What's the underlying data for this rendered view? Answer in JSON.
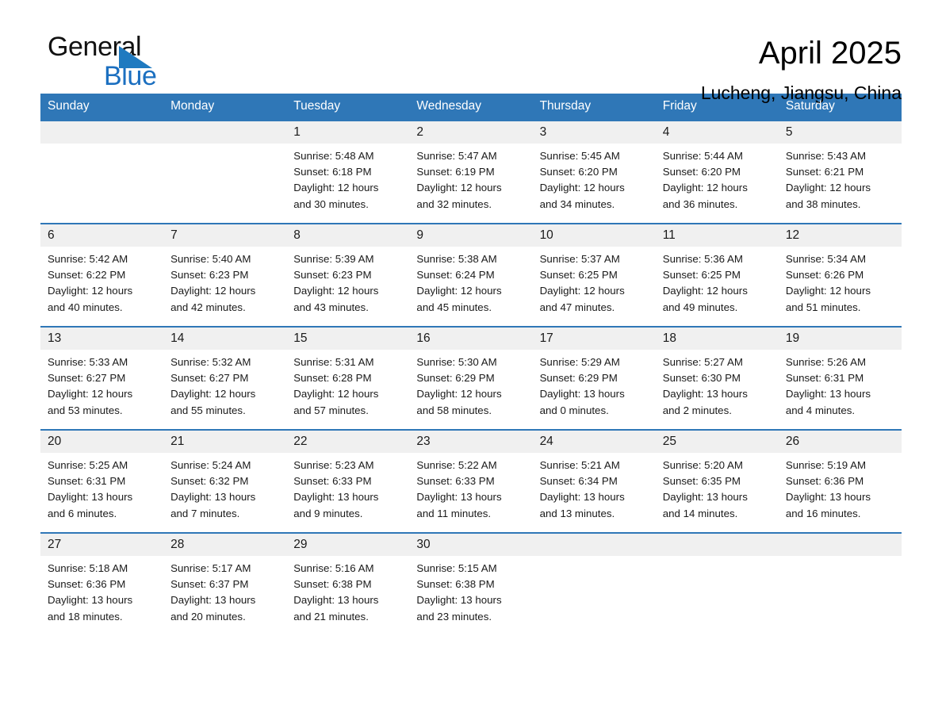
{
  "brand": {
    "name_top": "General",
    "name_bottom": "Blue",
    "accent_color": "#1b6fc0",
    "header_color": "#2f77b7"
  },
  "header": {
    "title": "April 2025",
    "subtitle": "Lucheng, Jiangsu, China"
  },
  "weekdays": [
    "Sunday",
    "Monday",
    "Tuesday",
    "Wednesday",
    "Thursday",
    "Friday",
    "Saturday"
  ],
  "labels": {
    "sunrise_prefix": "Sunrise: ",
    "sunset_prefix": "Sunset: ",
    "daylight_prefix": "Daylight: "
  },
  "weeks": [
    [
      {
        "day": "",
        "sunrise": "",
        "sunset": "",
        "daylight_line1": "",
        "daylight_line2": ""
      },
      {
        "day": "",
        "sunrise": "",
        "sunset": "",
        "daylight_line1": "",
        "daylight_line2": ""
      },
      {
        "day": "1",
        "sunrise": "Sunrise: 5:48 AM",
        "sunset": "Sunset: 6:18 PM",
        "daylight_line1": "Daylight: 12 hours",
        "daylight_line2": "and 30 minutes."
      },
      {
        "day": "2",
        "sunrise": "Sunrise: 5:47 AM",
        "sunset": "Sunset: 6:19 PM",
        "daylight_line1": "Daylight: 12 hours",
        "daylight_line2": "and 32 minutes."
      },
      {
        "day": "3",
        "sunrise": "Sunrise: 5:45 AM",
        "sunset": "Sunset: 6:20 PM",
        "daylight_line1": "Daylight: 12 hours",
        "daylight_line2": "and 34 minutes."
      },
      {
        "day": "4",
        "sunrise": "Sunrise: 5:44 AM",
        "sunset": "Sunset: 6:20 PM",
        "daylight_line1": "Daylight: 12 hours",
        "daylight_line2": "and 36 minutes."
      },
      {
        "day": "5",
        "sunrise": "Sunrise: 5:43 AM",
        "sunset": "Sunset: 6:21 PM",
        "daylight_line1": "Daylight: 12 hours",
        "daylight_line2": "and 38 minutes."
      }
    ],
    [
      {
        "day": "6",
        "sunrise": "Sunrise: 5:42 AM",
        "sunset": "Sunset: 6:22 PM",
        "daylight_line1": "Daylight: 12 hours",
        "daylight_line2": "and 40 minutes."
      },
      {
        "day": "7",
        "sunrise": "Sunrise: 5:40 AM",
        "sunset": "Sunset: 6:23 PM",
        "daylight_line1": "Daylight: 12 hours",
        "daylight_line2": "and 42 minutes."
      },
      {
        "day": "8",
        "sunrise": "Sunrise: 5:39 AM",
        "sunset": "Sunset: 6:23 PM",
        "daylight_line1": "Daylight: 12 hours",
        "daylight_line2": "and 43 minutes."
      },
      {
        "day": "9",
        "sunrise": "Sunrise: 5:38 AM",
        "sunset": "Sunset: 6:24 PM",
        "daylight_line1": "Daylight: 12 hours",
        "daylight_line2": "and 45 minutes."
      },
      {
        "day": "10",
        "sunrise": "Sunrise: 5:37 AM",
        "sunset": "Sunset: 6:25 PM",
        "daylight_line1": "Daylight: 12 hours",
        "daylight_line2": "and 47 minutes."
      },
      {
        "day": "11",
        "sunrise": "Sunrise: 5:36 AM",
        "sunset": "Sunset: 6:25 PM",
        "daylight_line1": "Daylight: 12 hours",
        "daylight_line2": "and 49 minutes."
      },
      {
        "day": "12",
        "sunrise": "Sunrise: 5:34 AM",
        "sunset": "Sunset: 6:26 PM",
        "daylight_line1": "Daylight: 12 hours",
        "daylight_line2": "and 51 minutes."
      }
    ],
    [
      {
        "day": "13",
        "sunrise": "Sunrise: 5:33 AM",
        "sunset": "Sunset: 6:27 PM",
        "daylight_line1": "Daylight: 12 hours",
        "daylight_line2": "and 53 minutes."
      },
      {
        "day": "14",
        "sunrise": "Sunrise: 5:32 AM",
        "sunset": "Sunset: 6:27 PM",
        "daylight_line1": "Daylight: 12 hours",
        "daylight_line2": "and 55 minutes."
      },
      {
        "day": "15",
        "sunrise": "Sunrise: 5:31 AM",
        "sunset": "Sunset: 6:28 PM",
        "daylight_line1": "Daylight: 12 hours",
        "daylight_line2": "and 57 minutes."
      },
      {
        "day": "16",
        "sunrise": "Sunrise: 5:30 AM",
        "sunset": "Sunset: 6:29 PM",
        "daylight_line1": "Daylight: 12 hours",
        "daylight_line2": "and 58 minutes."
      },
      {
        "day": "17",
        "sunrise": "Sunrise: 5:29 AM",
        "sunset": "Sunset: 6:29 PM",
        "daylight_line1": "Daylight: 13 hours",
        "daylight_line2": "and 0 minutes."
      },
      {
        "day": "18",
        "sunrise": "Sunrise: 5:27 AM",
        "sunset": "Sunset: 6:30 PM",
        "daylight_line1": "Daylight: 13 hours",
        "daylight_line2": "and 2 minutes."
      },
      {
        "day": "19",
        "sunrise": "Sunrise: 5:26 AM",
        "sunset": "Sunset: 6:31 PM",
        "daylight_line1": "Daylight: 13 hours",
        "daylight_line2": "and 4 minutes."
      }
    ],
    [
      {
        "day": "20",
        "sunrise": "Sunrise: 5:25 AM",
        "sunset": "Sunset: 6:31 PM",
        "daylight_line1": "Daylight: 13 hours",
        "daylight_line2": "and 6 minutes."
      },
      {
        "day": "21",
        "sunrise": "Sunrise: 5:24 AM",
        "sunset": "Sunset: 6:32 PM",
        "daylight_line1": "Daylight: 13 hours",
        "daylight_line2": "and 7 minutes."
      },
      {
        "day": "22",
        "sunrise": "Sunrise: 5:23 AM",
        "sunset": "Sunset: 6:33 PM",
        "daylight_line1": "Daylight: 13 hours",
        "daylight_line2": "and 9 minutes."
      },
      {
        "day": "23",
        "sunrise": "Sunrise: 5:22 AM",
        "sunset": "Sunset: 6:33 PM",
        "daylight_line1": "Daylight: 13 hours",
        "daylight_line2": "and 11 minutes."
      },
      {
        "day": "24",
        "sunrise": "Sunrise: 5:21 AM",
        "sunset": "Sunset: 6:34 PM",
        "daylight_line1": "Daylight: 13 hours",
        "daylight_line2": "and 13 minutes."
      },
      {
        "day": "25",
        "sunrise": "Sunrise: 5:20 AM",
        "sunset": "Sunset: 6:35 PM",
        "daylight_line1": "Daylight: 13 hours",
        "daylight_line2": "and 14 minutes."
      },
      {
        "day": "26",
        "sunrise": "Sunrise: 5:19 AM",
        "sunset": "Sunset: 6:36 PM",
        "daylight_line1": "Daylight: 13 hours",
        "daylight_line2": "and 16 minutes."
      }
    ],
    [
      {
        "day": "27",
        "sunrise": "Sunrise: 5:18 AM",
        "sunset": "Sunset: 6:36 PM",
        "daylight_line1": "Daylight: 13 hours",
        "daylight_line2": "and 18 minutes."
      },
      {
        "day": "28",
        "sunrise": "Sunrise: 5:17 AM",
        "sunset": "Sunset: 6:37 PM",
        "daylight_line1": "Daylight: 13 hours",
        "daylight_line2": "and 20 minutes."
      },
      {
        "day": "29",
        "sunrise": "Sunrise: 5:16 AM",
        "sunset": "Sunset: 6:38 PM",
        "daylight_line1": "Daylight: 13 hours",
        "daylight_line2": "and 21 minutes."
      },
      {
        "day": "30",
        "sunrise": "Sunrise: 5:15 AM",
        "sunset": "Sunset: 6:38 PM",
        "daylight_line1": "Daylight: 13 hours",
        "daylight_line2": "and 23 minutes."
      },
      {
        "day": "",
        "sunrise": "",
        "sunset": "",
        "daylight_line1": "",
        "daylight_line2": ""
      },
      {
        "day": "",
        "sunrise": "",
        "sunset": "",
        "daylight_line1": "",
        "daylight_line2": ""
      },
      {
        "day": "",
        "sunrise": "",
        "sunset": "",
        "daylight_line1": "",
        "daylight_line2": ""
      }
    ]
  ]
}
